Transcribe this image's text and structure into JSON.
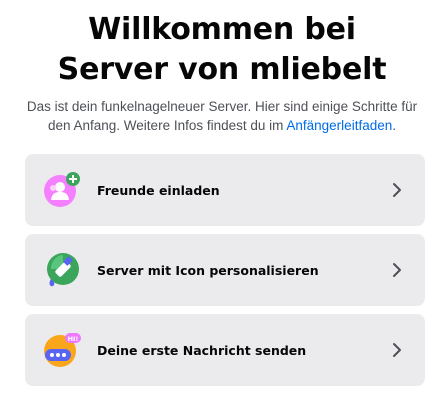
{
  "welcome": {
    "title_line1": "Willkommen bei",
    "title_line2": "Server von mliebelt",
    "subtitle_text": "Das ist dein funkelnagelneuer Server. Hier sind einige Schritte für den Anfang. Weitere Infos findest du im ",
    "subtitle_link": "Anfängerleitfaden",
    "subtitle_end": "."
  },
  "actions": [
    {
      "label": "Freunde einladen",
      "icon": "invite-friends-icon"
    },
    {
      "label": "Server mit Icon personalisieren",
      "icon": "personalize-server-icon"
    },
    {
      "label": "Deine erste Nachricht senden",
      "icon": "send-message-icon"
    }
  ],
  "icons": {
    "hi_badge": "HI!"
  },
  "colors": {
    "card_bg": "#ebebed",
    "link": "#006ce7",
    "invite_bg": "#f47fff",
    "personalize_bg": "#3ba55c",
    "message_bg": "#faa61a"
  }
}
